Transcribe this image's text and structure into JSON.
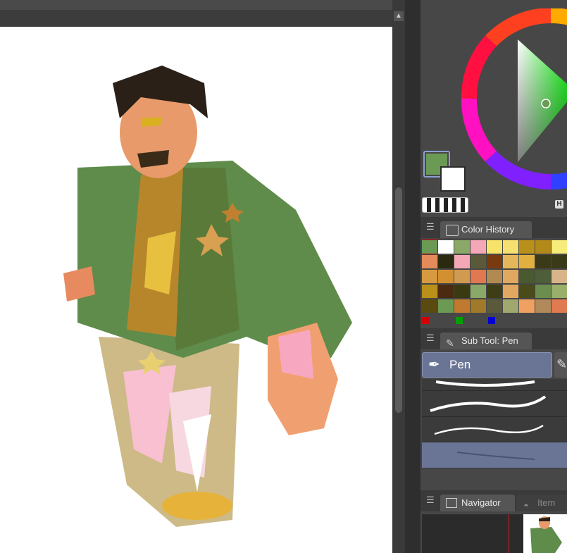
{
  "panels": {
    "color_history": {
      "tab_label": "Color History"
    },
    "subtool": {
      "tab_label": "Sub Tool: Pen",
      "selected_tool": "Pen",
      "next_tool_partial": ""
    },
    "navigator": {
      "tab_label": "Navigator",
      "second_tab_label": "Item"
    }
  },
  "color_wheel": {
    "main_color": "#6b9a55",
    "sub_color": "#ffffff",
    "h_label": "H"
  },
  "color_history": {
    "rows": [
      [
        "#6b9a55",
        "#ffffff",
        "#8aa868",
        "#f4a7b6",
        "#f7e36a",
        "#f5e070",
        "#b8901a",
        "#b38a1a",
        "#f7ec7a"
      ],
      [
        "#e58a5a",
        "#2a2a10",
        "#f4a7b6",
        "#5a5a3a",
        "#7a3a10",
        "#e4b85a",
        "#e0b040",
        "#3a3a18",
        "#3a3a18"
      ],
      [
        "#d89a40",
        "#d39030",
        "#d09a50",
        "#e07850",
        "#b08a50",
        "#e0a860",
        "#4a5a30",
        "#4e5e38",
        "#d8b48a"
      ],
      [
        "#b8901a",
        "#4a2a10",
        "#3a3a10",
        "#8aa868",
        "#3e3e16",
        "#e0a860",
        "#4a4a1a",
        "#6b8e4e",
        "#9ab06a"
      ],
      [
        "#5a4a10",
        "#6b9a55",
        "#c07a30",
        "#a07a2a",
        "#5a5a3a",
        "#a0a870",
        "#f0a060",
        "#b08a5a",
        "#e07a50"
      ]
    ],
    "rgb_indicators": [
      "#d00000",
      "#00a000",
      "#0000d0"
    ]
  }
}
